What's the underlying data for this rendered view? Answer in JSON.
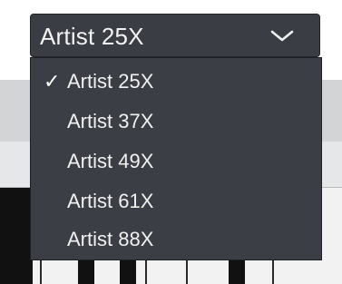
{
  "select": {
    "value": "Artist 25X",
    "chevron_icon": "chevron-down-icon"
  },
  "menu": {
    "selected_mark": "✓",
    "items": [
      {
        "label": "Artist 25X",
        "selected": true
      },
      {
        "label": "Artist 37X",
        "selected": false
      },
      {
        "label": "Artist 49X",
        "selected": false
      },
      {
        "label": "Artist 61X",
        "selected": false
      },
      {
        "label": "Artist 88X",
        "selected": false
      }
    ]
  },
  "colors": {
    "dropdown_bg": "#3a3d43",
    "menu_bg": "#3b3e44",
    "text": "#f1f1f1"
  }
}
